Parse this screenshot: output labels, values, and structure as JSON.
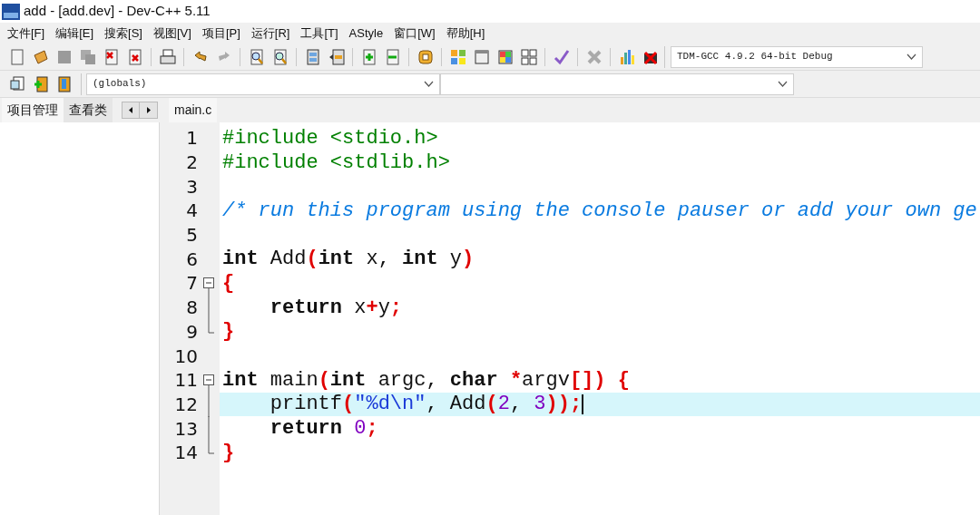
{
  "window": {
    "title": "add - [add.dev] - Dev-C++ 5.11"
  },
  "menu": [
    {
      "label": "文件[F]"
    },
    {
      "label": "编辑[E]"
    },
    {
      "label": "搜索[S]"
    },
    {
      "label": "视图[V]"
    },
    {
      "label": "项目[P]"
    },
    {
      "label": "运行[R]"
    },
    {
      "label": "工具[T]"
    },
    {
      "label": "AStyle"
    },
    {
      "label": "窗口[W]"
    },
    {
      "label": "帮助[H]"
    }
  ],
  "compiler_select": {
    "value": "TDM-GCC 4.9.2 64-bit Debug"
  },
  "scope_select": {
    "value": "(globals)"
  },
  "side_tabs": [
    {
      "label": "项目管理",
      "selected": true
    },
    {
      "label": "查看类",
      "selected": false
    }
  ],
  "editor_tabs": [
    {
      "label": "main.c",
      "selected": true
    }
  ],
  "code_lines": [
    {
      "number": "1",
      "kind": "plain",
      "tokens": [
        {
          "kind": "pre",
          "text": "#include <stdio.h>"
        }
      ]
    },
    {
      "number": "2",
      "kind": "plain",
      "tokens": [
        {
          "kind": "pre",
          "text": "#include <stdlib.h>"
        }
      ]
    },
    {
      "number": "3",
      "kind": "plain"
    },
    {
      "number": "4",
      "kind": "plain",
      "tokens": [
        {
          "kind": "comment",
          "text": "/* run this program using the console pauser or add your own ge"
        }
      ]
    },
    {
      "number": "5",
      "kind": "plain"
    },
    {
      "number": "6",
      "kind": "plain",
      "tokens": [
        {
          "kind": "keyword",
          "text": "int"
        },
        {
          "kind": "plain",
          "text": " Add"
        },
        {
          "kind": "symbol",
          "text": "("
        },
        {
          "kind": "keyword",
          "text": "int"
        },
        {
          "kind": "plain",
          "text": " x, "
        },
        {
          "kind": "keyword",
          "text": "int"
        },
        {
          "kind": "plain",
          "text": " y"
        },
        {
          "kind": "symbol",
          "text": ")"
        }
      ]
    },
    {
      "number": "7",
      "kind": "open",
      "tokens": [
        {
          "kind": "symbol",
          "text": "{"
        }
      ]
    },
    {
      "number": "8",
      "kind": "body",
      "tokens": [
        {
          "kind": "keyword",
          "text": "    return"
        },
        {
          "kind": "plain",
          "text": " x"
        },
        {
          "kind": "symbol",
          "text": "+"
        },
        {
          "kind": "plain",
          "text": "y"
        },
        {
          "kind": "symbol",
          "text": ";"
        }
      ]
    },
    {
      "number": "9",
      "kind": "close",
      "tokens": [
        {
          "kind": "symbol",
          "text": "}"
        }
      ]
    },
    {
      "number": "10",
      "kind": "plain"
    },
    {
      "number": "11",
      "kind": "open",
      "tokens": [
        {
          "kind": "keyword",
          "text": "int"
        },
        {
          "kind": "plain",
          "text": " main"
        },
        {
          "kind": "symbol",
          "text": "("
        },
        {
          "kind": "keyword",
          "text": "int"
        },
        {
          "kind": "plain",
          "text": " argc, "
        },
        {
          "kind": "keyword",
          "text": "char "
        },
        {
          "kind": "symbol",
          "text": "*"
        },
        {
          "kind": "plain",
          "text": "argv"
        },
        {
          "kind": "symbol",
          "text": "[]) {"
        }
      ]
    },
    {
      "number": "12",
      "kind": "body",
      "current": true,
      "tokens": [
        {
          "kind": "plain",
          "text": "    printf"
        },
        {
          "kind": "symbol",
          "text": "("
        },
        {
          "kind": "string",
          "text": "\"%d\\n\""
        },
        {
          "kind": "plain",
          "text": ", Add"
        },
        {
          "kind": "symbol",
          "text": "("
        },
        {
          "kind": "number",
          "text": "2"
        },
        {
          "kind": "plain",
          "text": ", "
        },
        {
          "kind": "number",
          "text": "3"
        },
        {
          "kind": "symbol",
          "text": "));"
        }
      ]
    },
    {
      "number": "13",
      "kind": "body",
      "tokens": [
        {
          "kind": "keyword",
          "text": "    return "
        },
        {
          "kind": "number",
          "text": "0"
        },
        {
          "kind": "symbol",
          "text": ";"
        }
      ]
    },
    {
      "number": "14",
      "kind": "close",
      "tokens": [
        {
          "kind": "symbol",
          "text": "}"
        }
      ]
    }
  ]
}
